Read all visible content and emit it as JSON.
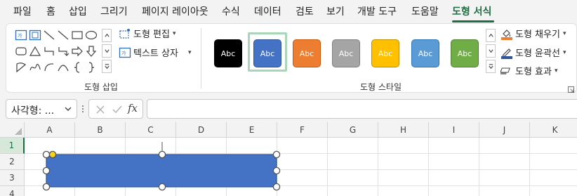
{
  "tabs": [
    {
      "label": "파일"
    },
    {
      "label": "홈"
    },
    {
      "label": "삽입"
    },
    {
      "label": "그리기"
    },
    {
      "label": "페이지 레이아웃"
    },
    {
      "label": "수식"
    },
    {
      "label": "데이터"
    },
    {
      "label": "검토"
    },
    {
      "label": "보기"
    },
    {
      "label": "개발 도구"
    },
    {
      "label": "도움말"
    },
    {
      "label": "도형 서식",
      "active": true
    }
  ],
  "ribbon": {
    "insert_shapes": {
      "group_label": "도형 삽입",
      "edit_shape": "도형 편집",
      "text_box": "텍스트 상자"
    },
    "shape_styles": {
      "group_label": "도형 스타일",
      "styles": [
        {
          "label": "Abc",
          "fill": "#000000",
          "border": "#000000"
        },
        {
          "label": "Abc",
          "fill": "#4472c4",
          "border": "#2f5597",
          "selected": true
        },
        {
          "label": "Abc",
          "fill": "#ed7d31",
          "border": "#c55a11"
        },
        {
          "label": "Abc",
          "fill": "#a5a5a5",
          "border": "#7f7f7f"
        },
        {
          "label": "Abc",
          "fill": "#ffc000",
          "border": "#bf9000"
        },
        {
          "label": "Abc",
          "fill": "#5b9bd5",
          "border": "#2e75b6"
        },
        {
          "label": "Abc",
          "fill": "#70ad47",
          "border": "#548235"
        }
      ],
      "shape_fill": "도형 채우기",
      "shape_outline": "도형 윤곽선",
      "shape_effects": "도형 효과"
    }
  },
  "formula_bar": {
    "name_box": "사각형: ...",
    "fx": "fx",
    "formula": ""
  },
  "grid": {
    "columns": [
      "A",
      "B",
      "C",
      "D",
      "E",
      "F",
      "G",
      "H",
      "I",
      "J",
      "K"
    ],
    "rows": [
      "1",
      "2",
      "3",
      "4"
    ],
    "selected_row": "1"
  },
  "colors": {
    "accent": "#1f6e43",
    "shape_fill": "#4472c4",
    "shape_outline": "#2f5597",
    "fill_indicator": "#ed7d31",
    "outline_indicator": "#2f5597"
  }
}
